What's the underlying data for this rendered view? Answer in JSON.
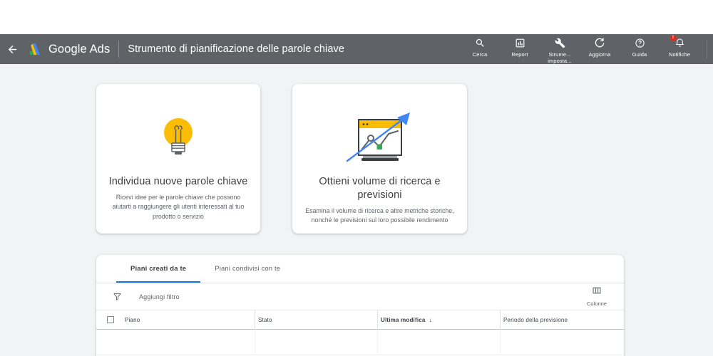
{
  "header": {
    "back_icon": "arrow-left-icon",
    "brand_logo_icon": "google-ads-logo-icon",
    "brand_name": "Google Ads",
    "app_title": "Strumento di pianificazione delle parole chiave",
    "bg_color": "#5f6368",
    "tools": [
      {
        "icon": "search-icon",
        "label": "Cerca"
      },
      {
        "icon": "report-chart-icon",
        "label": "Report"
      },
      {
        "icon": "wrench-tools-icon",
        "label": "Strume...\nimposta..."
      },
      {
        "icon": "refresh-icon",
        "label": "Aggiorna"
      },
      {
        "icon": "help-circle-icon",
        "label": "Guida"
      },
      {
        "icon": "notifications-bell-icon",
        "label": "Notifiche",
        "badge": "!"
      }
    ]
  },
  "cards": [
    {
      "art_icon": "lightbulb-icon",
      "title": "Individua nuove parole chiave",
      "description": "Ricevi idee per le parole chiave che possono aiutarti a raggiungere gli utenti interessati al tuo prodotto o servizio"
    },
    {
      "art_icon": "forecast-chart-window-icon",
      "title": "Ottieni volume di ricerca e previsioni",
      "description": "Esamina il volume di ricerca e altre metriche storiche, nonché le previsioni sul loro possibile rendimento"
    }
  ],
  "panel": {
    "tabs": [
      {
        "label": "Piani creati da te",
        "active": true
      },
      {
        "label": "Piani condivisi con te",
        "active": false
      }
    ],
    "filter": {
      "icon": "filter-funnel-icon",
      "add_filter_label": "Aggiungi filtro"
    },
    "columns_button": {
      "icon": "columns-icon",
      "label": "Colonne"
    },
    "table": {
      "select_all_checkbox": "unchecked",
      "columns": [
        {
          "label": "Piano",
          "sorted": false
        },
        {
          "label": "Stato",
          "sorted": false
        },
        {
          "label": "Ultima modifica",
          "sorted": true,
          "sort_direction": "↓"
        },
        {
          "label": "Periodo della previsione",
          "sorted": false
        }
      ]
    }
  },
  "colors": {
    "appbar": "#5f6368",
    "content_bg": "#f1f3f4",
    "accent_blue": "#1a73e8",
    "lightbulb_yellow": "#fbbc04",
    "badge_red": "#d93025",
    "text_primary": "#3c4043",
    "text_secondary": "#5f6368"
  }
}
